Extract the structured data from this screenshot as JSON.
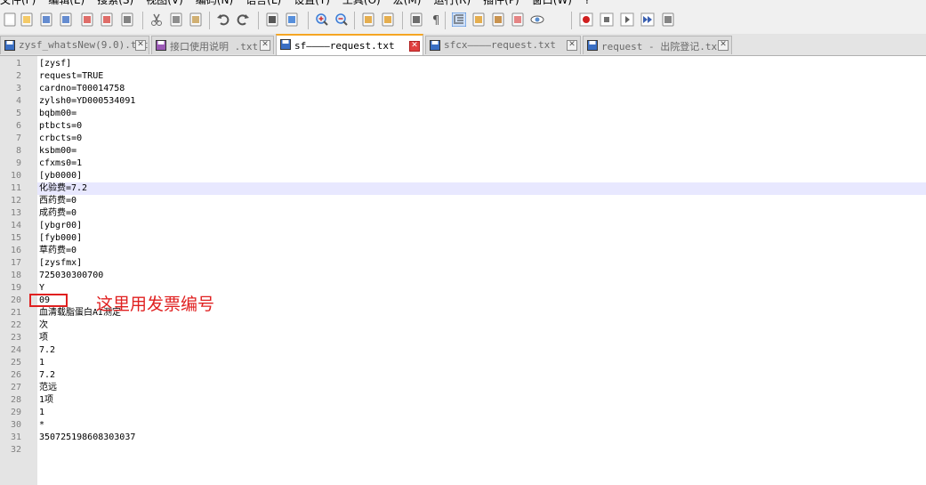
{
  "menu": [
    "文件(F)",
    "编辑(E)",
    "搜索(S)",
    "视图(V)",
    "编码(N)",
    "语言(L)",
    "设置(T)",
    "工具(O)",
    "宏(M)",
    "运行(R)",
    "插件(P)",
    "窗口(W)",
    "?"
  ],
  "toolbar": [
    "new-file-icon",
    "open-file-icon",
    "save-icon",
    "save-all-icon",
    "close-icon",
    "close-all-icon",
    "print-icon",
    "cut-icon",
    "copy-icon",
    "paste-icon",
    "undo-icon",
    "redo-icon",
    "find-icon",
    "replace-icon",
    "zoom-in-icon",
    "zoom-out-icon",
    "sync-vertical-icon",
    "sync-horizontal-icon",
    "word-wrap-icon",
    "show-all-chars-icon",
    "indent-guide-icon",
    "doc-map-icon",
    "function-list-icon",
    "folder-workspace-icon",
    "monitor-icon",
    "record-macro-icon",
    "stop-macro-icon",
    "play-macro-icon",
    "run-macro-multiple-icon",
    "save-macro-icon"
  ],
  "tabs": [
    {
      "label": "zysf_whatsNew(9.0).txt",
      "active": false,
      "icon_color": "#3a6fc4"
    },
    {
      "label": "接口使用说明 .txt",
      "active": false,
      "icon_color": "#9b59b6"
    },
    {
      "label": "sf————request.txt",
      "active": true,
      "icon_color": "#3a6fc4"
    },
    {
      "label": "sfcx————request.txt",
      "active": false,
      "icon_color": "#3a6fc4"
    },
    {
      "label": "request - 出院登记.txt",
      "active": false,
      "icon_color": "#3a6fc4"
    }
  ],
  "editor": {
    "current_line": 11,
    "lines": [
      {
        "n": "1",
        "text": "[zysf]"
      },
      {
        "n": "2",
        "text": "request=TRUE"
      },
      {
        "n": "3",
        "text": "cardno=T00014758"
      },
      {
        "n": "4",
        "text": "zylsh0=YD000534091"
      },
      {
        "n": "5",
        "text": "bqbm00="
      },
      {
        "n": "6",
        "text": "ptbcts=0"
      },
      {
        "n": "7",
        "text": "crbcts=0"
      },
      {
        "n": "8",
        "text": "ksbm00="
      },
      {
        "n": "9",
        "text": "cfxms0=1"
      },
      {
        "n": "10",
        "text": "[yb0000]"
      },
      {
        "n": "11",
        "text": "化验费=7.2"
      },
      {
        "n": "12",
        "text": "西药费=0"
      },
      {
        "n": "13",
        "text": "成药费=0"
      },
      {
        "n": "14",
        "text": "[ybgr00]"
      },
      {
        "n": "15",
        "text": "[fyb000]"
      },
      {
        "n": "16",
        "text": "草药费=0"
      },
      {
        "n": "17",
        "text": "[zysfmx]"
      },
      {
        "n": "18",
        "text": "725030300700"
      },
      {
        "n": "19",
        "text": "Y"
      },
      {
        "n": "20",
        "text": "09"
      },
      {
        "n": "21",
        "text": "血清载脂蛋白AI测定"
      },
      {
        "n": "22",
        "text": "次"
      },
      {
        "n": "23",
        "text": "项"
      },
      {
        "n": "24",
        "text": "7.2"
      },
      {
        "n": "25",
        "text": "1"
      },
      {
        "n": "26",
        "text": "7.2"
      },
      {
        "n": "27",
        "text": "范远"
      },
      {
        "n": "28",
        "text": "1项"
      },
      {
        "n": "29",
        "text": "1"
      },
      {
        "n": "30",
        "text": "*"
      },
      {
        "n": "31",
        "text": "350725198608303037"
      },
      {
        "n": "32",
        "text": ""
      }
    ]
  },
  "annotation": {
    "text": "这里用发票编号",
    "color": "#e02020"
  }
}
